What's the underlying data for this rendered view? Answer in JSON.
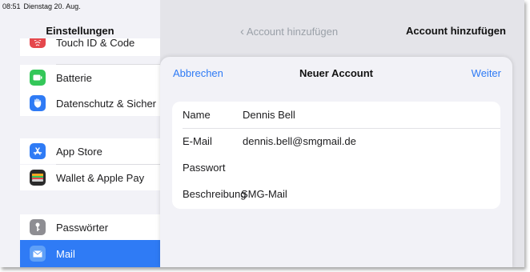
{
  "status_bar": {
    "time": "08:51",
    "date": "Dienstag 20. Aug."
  },
  "sidebar": {
    "title": "Einstellungen",
    "items": [
      {
        "label": "Touch ID & Code",
        "icon": "fingerprint-icon",
        "color": "#e5484d"
      },
      {
        "label": "Batterie",
        "icon": "battery-icon",
        "color": "#34c759"
      },
      {
        "label": "Datenschutz & Sicherheit",
        "icon": "hand-icon",
        "color": "#2f7bf5"
      },
      {
        "label": "App Store",
        "icon": "app-store-icon",
        "color": "#2f7bf5"
      },
      {
        "label": "Wallet & Apple Pay",
        "icon": "wallet-icon",
        "color": "#2b2b2b"
      },
      {
        "label": "Passwörter",
        "icon": "key-icon",
        "color": "#8e8e93"
      },
      {
        "label": "Mail",
        "icon": "mail-icon",
        "color": "#3b82f6"
      }
    ],
    "selected": "Mail"
  },
  "detail": {
    "back_label": "Account hinzufügen",
    "title": "Account hinzufügen"
  },
  "sheet": {
    "cancel_label": "Abbrechen",
    "title": "Neuer Account",
    "next_label": "Weiter",
    "fields": [
      {
        "label": "Name",
        "value": "Dennis Bell"
      },
      {
        "label": "E-Mail",
        "value": "dennis.bell@smgmail.de"
      },
      {
        "label": "Passwort",
        "value": ""
      },
      {
        "label": "Beschreibung",
        "value": "SMG-Mail"
      }
    ]
  },
  "colors": {
    "accent": "#2f7bf5",
    "background": "#f2f2f7"
  }
}
